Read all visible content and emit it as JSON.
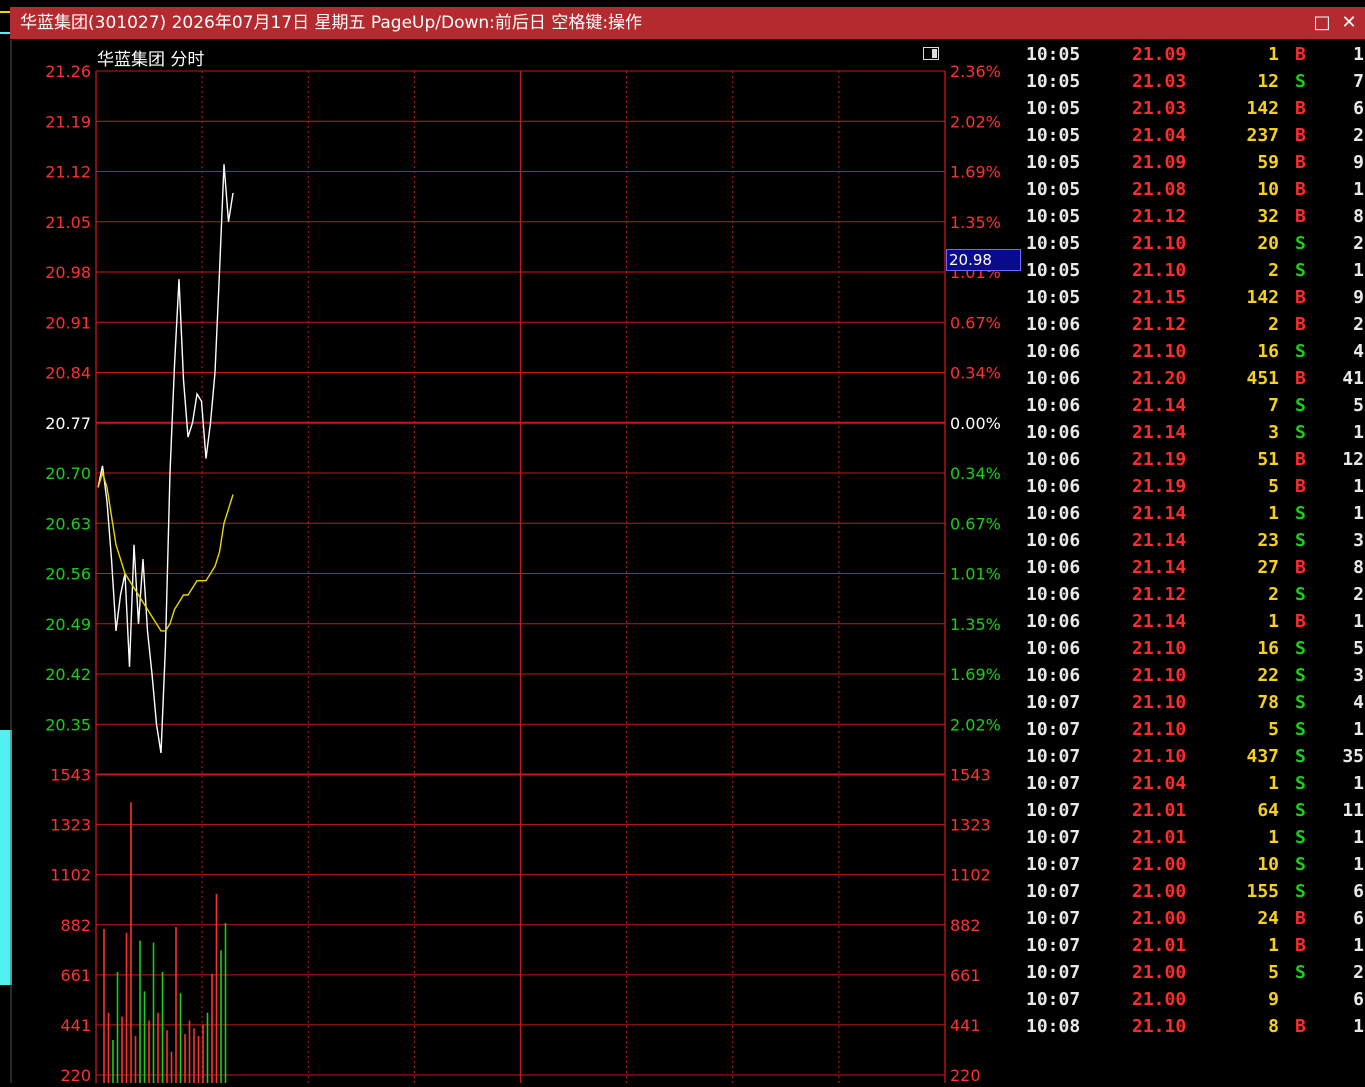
{
  "window": {
    "title": "华蓝集团(301027) 2026年07月17日 星期五 PageUp/Down:前后日 空格键:操作",
    "buttons": [
      "□",
      "✕"
    ]
  },
  "chart": {
    "label": "华蓝集团  分时",
    "current_price_tag": "20.98",
    "left_price_labels": [
      "21.26",
      "21.19",
      "21.12",
      "21.05",
      "20.98",
      "20.91",
      "20.84",
      "20.77",
      "20.70",
      "20.63",
      "20.56",
      "20.49",
      "20.42",
      "20.35"
    ],
    "right_pct_labels": [
      "2.36%",
      "2.02%",
      "1.69%",
      "1.35%",
      "1.01%",
      "0.67%",
      "0.34%",
      "0.00%",
      "0.34%",
      "0.67%",
      "1.01%",
      "1.35%",
      "1.69%",
      "2.02%"
    ],
    "volume_labels": [
      "1543",
      "1323",
      "1102",
      "882",
      "661",
      "441",
      "220"
    ],
    "colors": {
      "up": "#ff3030",
      "down": "#18d018",
      "flat": "#ffffff",
      "grid": "#c81818",
      "price_line": "#ffffff",
      "avg_line": "#e8d800"
    }
  },
  "chart_data": {
    "type": "line",
    "prev_close": 20.77,
    "ylim": [
      20.35,
      21.26
    ],
    "series": [
      {
        "values": [
          20.68,
          20.71,
          20.66,
          20.58,
          20.48,
          20.53,
          20.56,
          20.43,
          20.6,
          20.49,
          20.58,
          20.48,
          20.42,
          20.35,
          20.31,
          20.46,
          20.7,
          20.85,
          20.97,
          20.83,
          20.75,
          20.77,
          20.81,
          20.8,
          20.72,
          20.77,
          20.84,
          20.98,
          21.13,
          21.05,
          21.09
        ]
      },
      {
        "values": [
          20.68,
          20.7,
          20.68,
          20.64,
          20.6,
          20.58,
          20.56,
          20.55,
          20.54,
          20.53,
          20.52,
          20.51,
          20.5,
          20.49,
          20.48,
          20.48,
          20.49,
          20.51,
          20.52,
          20.53,
          20.53,
          20.54,
          20.55,
          20.55,
          20.55,
          20.56,
          20.57,
          20.59,
          20.63,
          20.65,
          20.67
        ]
      }
    ],
    "volume": {
      "values": [
        750,
        320,
        180,
        530,
        300,
        730,
        1400,
        200,
        690,
        430,
        280,
        680,
        320,
        530,
        230,
        120,
        760,
        420,
        210,
        280,
        240,
        200,
        260,
        320,
        520,
        930,
        640,
        780
      ],
      "colors": [
        "up",
        "up",
        "down",
        "down",
        "up",
        "up",
        "up",
        "up",
        "down",
        "down",
        "up",
        "down",
        "up",
        "down",
        "up",
        "up",
        "up",
        "down",
        "up",
        "up",
        "up",
        "up",
        "up",
        "down",
        "up",
        "up",
        "down",
        "down"
      ]
    }
  },
  "ticks": [
    {
      "time": "10:05",
      "price": "21.09",
      "vol": "1",
      "side": "B",
      "cnt": "1"
    },
    {
      "time": "10:05",
      "price": "21.03",
      "vol": "12",
      "side": "S",
      "cnt": "7"
    },
    {
      "time": "10:05",
      "price": "21.03",
      "vol": "142",
      "side": "B",
      "cnt": "6"
    },
    {
      "time": "10:05",
      "price": "21.04",
      "vol": "237",
      "side": "B",
      "cnt": "2"
    },
    {
      "time": "10:05",
      "price": "21.09",
      "vol": "59",
      "side": "B",
      "cnt": "9"
    },
    {
      "time": "10:05",
      "price": "21.08",
      "vol": "10",
      "side": "B",
      "cnt": "1"
    },
    {
      "time": "10:05",
      "price": "21.12",
      "vol": "32",
      "side": "B",
      "cnt": "8"
    },
    {
      "time": "10:05",
      "price": "21.10",
      "vol": "20",
      "side": "S",
      "cnt": "2"
    },
    {
      "time": "10:05",
      "price": "21.10",
      "vol": "2",
      "side": "S",
      "cnt": "1"
    },
    {
      "time": "10:05",
      "price": "21.15",
      "vol": "142",
      "side": "B",
      "cnt": "9"
    },
    {
      "time": "10:06",
      "price": "21.12",
      "vol": "2",
      "side": "B",
      "cnt": "2"
    },
    {
      "time": "10:06",
      "price": "21.10",
      "vol": "16",
      "side": "S",
      "cnt": "4"
    },
    {
      "time": "10:06",
      "price": "21.20",
      "vol": "451",
      "side": "B",
      "cnt": "41"
    },
    {
      "time": "10:06",
      "price": "21.14",
      "vol": "7",
      "side": "S",
      "cnt": "5"
    },
    {
      "time": "10:06",
      "price": "21.14",
      "vol": "3",
      "side": "S",
      "cnt": "1"
    },
    {
      "time": "10:06",
      "price": "21.19",
      "vol": "51",
      "side": "B",
      "cnt": "12"
    },
    {
      "time": "10:06",
      "price": "21.19",
      "vol": "5",
      "side": "B",
      "cnt": "1"
    },
    {
      "time": "10:06",
      "price": "21.14",
      "vol": "1",
      "side": "S",
      "cnt": "1"
    },
    {
      "time": "10:06",
      "price": "21.14",
      "vol": "23",
      "side": "S",
      "cnt": "3"
    },
    {
      "time": "10:06",
      "price": "21.14",
      "vol": "27",
      "side": "B",
      "cnt": "8"
    },
    {
      "time": "10:06",
      "price": "21.12",
      "vol": "2",
      "side": "S",
      "cnt": "2"
    },
    {
      "time": "10:06",
      "price": "21.14",
      "vol": "1",
      "side": "B",
      "cnt": "1"
    },
    {
      "time": "10:06",
      "price": "21.10",
      "vol": "16",
      "side": "S",
      "cnt": "5"
    },
    {
      "time": "10:06",
      "price": "21.10",
      "vol": "22",
      "side": "S",
      "cnt": "3"
    },
    {
      "time": "10:07",
      "price": "21.10",
      "vol": "78",
      "side": "S",
      "cnt": "4"
    },
    {
      "time": "10:07",
      "price": "21.10",
      "vol": "5",
      "side": "S",
      "cnt": "1"
    },
    {
      "time": "10:07",
      "price": "21.10",
      "vol": "437",
      "side": "S",
      "cnt": "35"
    },
    {
      "time": "10:07",
      "price": "21.04",
      "vol": "1",
      "side": "S",
      "cnt": "1"
    },
    {
      "time": "10:07",
      "price": "21.01",
      "vol": "64",
      "side": "S",
      "cnt": "11"
    },
    {
      "time": "10:07",
      "price": "21.01",
      "vol": "1",
      "side": "S",
      "cnt": "1"
    },
    {
      "time": "10:07",
      "price": "21.00",
      "vol": "10",
      "side": "S",
      "cnt": "1"
    },
    {
      "time": "10:07",
      "price": "21.00",
      "vol": "155",
      "side": "S",
      "cnt": "6"
    },
    {
      "time": "10:07",
      "price": "21.00",
      "vol": "24",
      "side": "B",
      "cnt": "6"
    },
    {
      "time": "10:07",
      "price": "21.01",
      "vol": "1",
      "side": "B",
      "cnt": "1"
    },
    {
      "time": "10:07",
      "price": "21.00",
      "vol": "5",
      "side": "S",
      "cnt": "2"
    },
    {
      "time": "10:07",
      "price": "21.00",
      "vol": "9",
      "side": "",
      "cnt": "6"
    }
  ],
  "ticks_partial": [
    {
      "time": "10:08",
      "price": "21.10",
      "vol": "8",
      "side": "B",
      "cnt": "1"
    }
  ]
}
